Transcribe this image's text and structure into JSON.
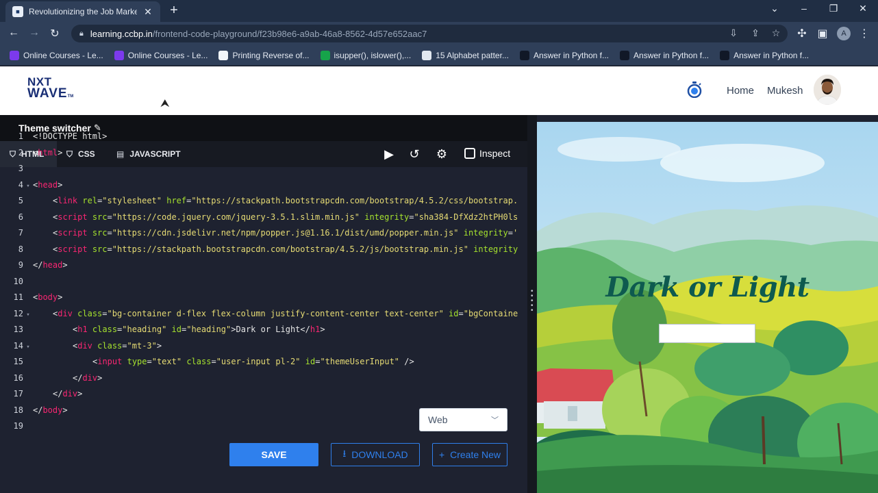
{
  "browser": {
    "tab_title": "Revolutionizing the Job Market |",
    "tab_close": "✕",
    "new_tab": "+",
    "url_host": "learning.ccbp.in",
    "url_path": "/frontend-code-playground/f23b98e6-a9ab-46a8-8562-4d57e652aac7",
    "profile_initial": "A",
    "bookmarks": [
      {
        "label": "Online Courses - Le...",
        "icon_color": "#7c3aed"
      },
      {
        "label": "Online Courses - Le...",
        "icon_color": "#7c3aed"
      },
      {
        "label": "Printing Reverse of...",
        "icon_color": "#f1f5f9"
      },
      {
        "label": "isupper(), islower(),...",
        "icon_color": "#16a34a"
      },
      {
        "label": "15 Alphabet patter...",
        "icon_color": "#e2e8f0"
      },
      {
        "label": "Answer in Python f...",
        "icon_color": "#111827"
      },
      {
        "label": "Answer in Python f...",
        "icon_color": "#111827"
      },
      {
        "label": "Answer in Python f...",
        "icon_color": "#111827"
      }
    ]
  },
  "header": {
    "logo_top": "NXT",
    "logo_bottom": "WAVE",
    "logo_tm": "TM",
    "nav_home": "Home",
    "nav_user": "Mukesh"
  },
  "editor": {
    "title": "Theme switcher",
    "tabs": [
      "HTML",
      "CSS",
      "JAVASCRIPT"
    ],
    "active_tab": "HTML",
    "inspect_label": "Inspect",
    "select_value": "Web",
    "save_label": "SAVE",
    "download_label": "DOWNLOAD",
    "create_label": "Create New",
    "lines": [
      {
        "n": "1",
        "fold": false,
        "indent": 0,
        "parts": [
          [
            "pl",
            "<!DOCTYPE html>"
          ]
        ]
      },
      {
        "n": "2",
        "fold": false,
        "indent": 0,
        "parts": [
          [
            "pl",
            "<"
          ],
          [
            "tg",
            "html"
          ],
          [
            "pl",
            ">"
          ]
        ]
      },
      {
        "n": "3",
        "fold": false,
        "indent": 0,
        "parts": []
      },
      {
        "n": "4",
        "fold": true,
        "indent": 0,
        "parts": [
          [
            "pl",
            "<"
          ],
          [
            "tg",
            "head"
          ],
          [
            "pl",
            ">"
          ]
        ]
      },
      {
        "n": "5",
        "fold": false,
        "indent": 1,
        "parts": [
          [
            "pl",
            "<"
          ],
          [
            "tg",
            "link"
          ],
          [
            "pl",
            " "
          ],
          [
            "at",
            "rel"
          ],
          [
            "pl",
            "="
          ],
          [
            "st",
            "\"stylesheet\""
          ],
          [
            "pl",
            " "
          ],
          [
            "at",
            "href"
          ],
          [
            "pl",
            "="
          ],
          [
            "st",
            "\"https://stackpath.bootstrapcdn.com/bootstrap/4.5.2/css/bootstrap."
          ]
        ]
      },
      {
        "n": "6",
        "fold": false,
        "indent": 1,
        "parts": [
          [
            "pl",
            "<"
          ],
          [
            "tg",
            "script"
          ],
          [
            "pl",
            " "
          ],
          [
            "at",
            "src"
          ],
          [
            "pl",
            "="
          ],
          [
            "st",
            "\"https://code.jquery.com/jquery-3.5.1.slim.min.js\""
          ],
          [
            "pl",
            " "
          ],
          [
            "at",
            "integrity"
          ],
          [
            "pl",
            "="
          ],
          [
            "st",
            "\"sha384-DfXdz2htPH0ls"
          ]
        ]
      },
      {
        "n": "7",
        "fold": false,
        "indent": 1,
        "parts": [
          [
            "pl",
            "<"
          ],
          [
            "tg",
            "script"
          ],
          [
            "pl",
            " "
          ],
          [
            "at",
            "src"
          ],
          [
            "pl",
            "="
          ],
          [
            "st",
            "\"https://cdn.jsdelivr.net/npm/popper.js@1.16.1/dist/umd/popper.min.js\""
          ],
          [
            "pl",
            " "
          ],
          [
            "at",
            "integrity"
          ],
          [
            "pl",
            "="
          ],
          [
            "st",
            "'"
          ]
        ]
      },
      {
        "n": "8",
        "fold": false,
        "indent": 1,
        "parts": [
          [
            "pl",
            "<"
          ],
          [
            "tg",
            "script"
          ],
          [
            "pl",
            " "
          ],
          [
            "at",
            "src"
          ],
          [
            "pl",
            "="
          ],
          [
            "st",
            "\"https://stackpath.bootstrapcdn.com/bootstrap/4.5.2/js/bootstrap.min.js\""
          ],
          [
            "pl",
            " "
          ],
          [
            "at",
            "integrity"
          ]
        ]
      },
      {
        "n": "9",
        "fold": false,
        "indent": 0,
        "parts": [
          [
            "pl",
            "</"
          ],
          [
            "tg",
            "head"
          ],
          [
            "pl",
            ">"
          ]
        ]
      },
      {
        "n": "10",
        "fold": false,
        "indent": 0,
        "parts": []
      },
      {
        "n": "11",
        "fold": false,
        "indent": 0,
        "parts": [
          [
            "pl",
            "<"
          ],
          [
            "tg",
            "body"
          ],
          [
            "pl",
            ">"
          ]
        ]
      },
      {
        "n": "12",
        "fold": true,
        "indent": 1,
        "parts": [
          [
            "pl",
            "<"
          ],
          [
            "tg",
            "div"
          ],
          [
            "pl",
            " "
          ],
          [
            "at",
            "class"
          ],
          [
            "pl",
            "="
          ],
          [
            "st",
            "\"bg-container d-flex flex-column justify-content-center text-center\""
          ],
          [
            "pl",
            " "
          ],
          [
            "at",
            "id"
          ],
          [
            "pl",
            "="
          ],
          [
            "st",
            "\"bgContaine"
          ]
        ]
      },
      {
        "n": "13",
        "fold": false,
        "indent": 2,
        "parts": [
          [
            "pl",
            "<"
          ],
          [
            "tg",
            "h1"
          ],
          [
            "pl",
            " "
          ],
          [
            "at",
            "class"
          ],
          [
            "pl",
            "="
          ],
          [
            "st",
            "\"heading\""
          ],
          [
            "pl",
            " "
          ],
          [
            "at",
            "id"
          ],
          [
            "pl",
            "="
          ],
          [
            "st",
            "\"heading\""
          ],
          [
            "pl",
            ">Dark or Light</"
          ],
          [
            "tg",
            "h1"
          ],
          [
            "pl",
            ">"
          ]
        ]
      },
      {
        "n": "14",
        "fold": true,
        "indent": 2,
        "parts": [
          [
            "pl",
            "<"
          ],
          [
            "tg",
            "div"
          ],
          [
            "pl",
            " "
          ],
          [
            "at",
            "class"
          ],
          [
            "pl",
            "="
          ],
          [
            "st",
            "\"mt-3\""
          ],
          [
            "pl",
            ">"
          ]
        ]
      },
      {
        "n": "15",
        "fold": false,
        "indent": 3,
        "parts": [
          [
            "pl",
            "<"
          ],
          [
            "tg",
            "input"
          ],
          [
            "pl",
            " "
          ],
          [
            "at",
            "type"
          ],
          [
            "pl",
            "="
          ],
          [
            "st",
            "\"text\""
          ],
          [
            "pl",
            " "
          ],
          [
            "at",
            "class"
          ],
          [
            "pl",
            "="
          ],
          [
            "st",
            "\"user-input pl-2\""
          ],
          [
            "pl",
            " "
          ],
          [
            "at",
            "id"
          ],
          [
            "pl",
            "="
          ],
          [
            "st",
            "\"themeUserInput\""
          ],
          [
            "pl",
            " />"
          ]
        ]
      },
      {
        "n": "16",
        "fold": false,
        "indent": 2,
        "parts": [
          [
            "pl",
            "</"
          ],
          [
            "tg",
            "div"
          ],
          [
            "pl",
            ">"
          ]
        ]
      },
      {
        "n": "17",
        "fold": false,
        "indent": 1,
        "parts": [
          [
            "pl",
            "</"
          ],
          [
            "tg",
            "div"
          ],
          [
            "pl",
            ">"
          ]
        ]
      },
      {
        "n": "18",
        "fold": false,
        "indent": 0,
        "parts": [
          [
            "pl",
            "</"
          ],
          [
            "tg",
            "body"
          ],
          [
            "pl",
            ">"
          ]
        ]
      },
      {
        "n": "19",
        "fold": false,
        "indent": 0,
        "parts": []
      }
    ]
  },
  "preview": {
    "heading": "Dark or Light"
  }
}
